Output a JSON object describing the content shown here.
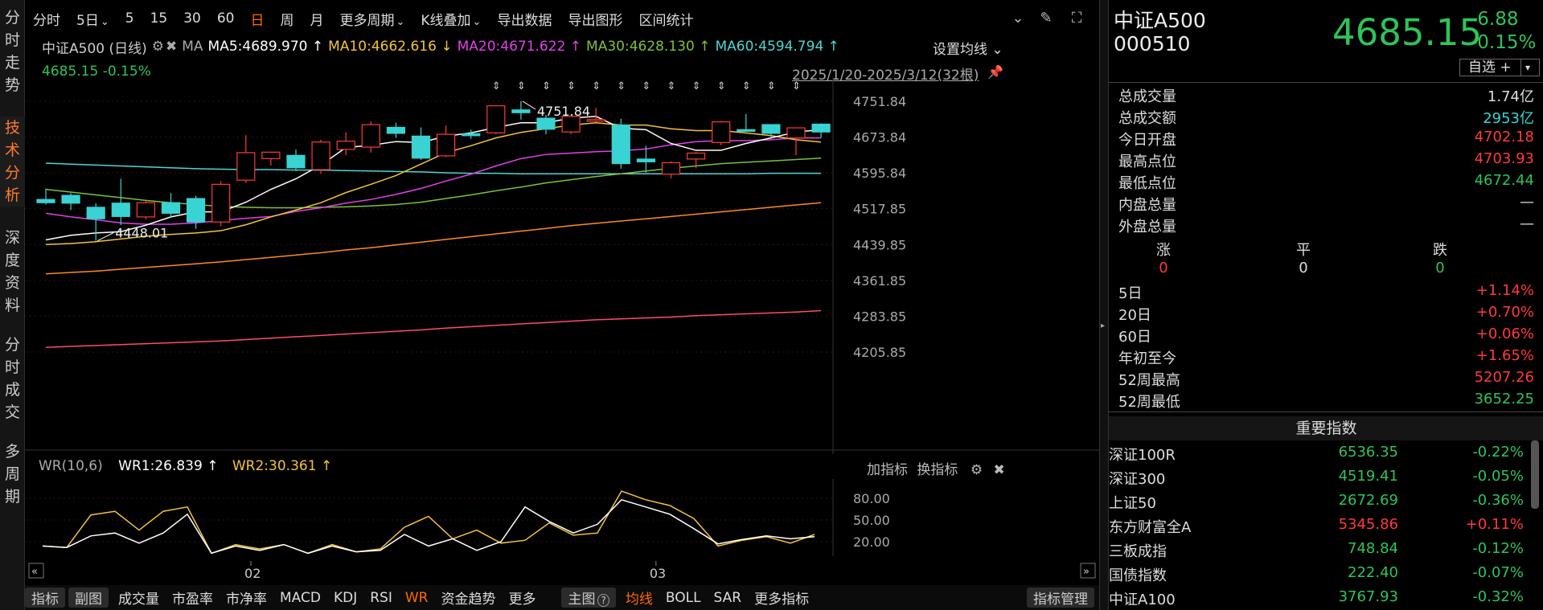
{
  "left_nav": [
    {
      "label": "分时走势"
    },
    {
      "label": "技术分析",
      "active": true
    },
    {
      "label": "深度资料"
    },
    {
      "label": "分时成交"
    },
    {
      "label": "多周期"
    }
  ],
  "toolbar": {
    "items": [
      "分时",
      "5日",
      "5",
      "15",
      "30",
      "60",
      "日",
      "周",
      "月",
      "更多周期",
      "K线叠加",
      "导出数据",
      "导出图形",
      "区间统计"
    ],
    "active": "日",
    "dropdowns": [
      "5日",
      "更多周期",
      "K线叠加"
    ]
  },
  "ma_line": {
    "name": "中证A500 (日线)",
    "ma_label": "MA",
    "ma5": "MA5:4689.970",
    "ma5_arrow": "↑",
    "ma10": "MA10:4662.616",
    "ma10_arrow": "↓",
    "ma20": "MA20:4671.622",
    "ma20_arrow": "↑",
    "ma30": "MA30:4628.130",
    "ma30_arrow": "↑",
    "ma60": "MA60:4594.794",
    "ma60_arrow": "↑",
    "set_ma": "设置均线",
    "colors": {
      "ma5": "#ffffff",
      "ma10": "#f2c33c",
      "ma20": "#e040e8",
      "ma30": "#7ec03a",
      "ma60": "#4fd4d4",
      "ma120": "#ff8a20",
      "ma250": "#ff4a6a"
    }
  },
  "price_change": "4685.15 -0.15%",
  "date_range": "2025/1/20-2025/3/12(32根)",
  "y_axis": [
    "4751.84",
    "4673.84",
    "4595.84",
    "4517.85",
    "4439.85",
    "4361.85",
    "4283.85",
    "4205.85"
  ],
  "annotations": {
    "high": "4751.84",
    "low": "4448.01"
  },
  "chart_data": {
    "type": "candlestick",
    "ylim": [
      4205.85,
      4751.84
    ],
    "up_color": "#ff3a3a",
    "down_color": "#39d3d3",
    "candles": [
      {
        "o": 4538,
        "h": 4562,
        "l": 4527,
        "c": 4531
      },
      {
        "o": 4547,
        "h": 4552,
        "l": 4515,
        "c": 4530
      },
      {
        "o": 4521,
        "h": 4530,
        "l": 4448,
        "c": 4496
      },
      {
        "o": 4530,
        "h": 4583,
        "l": 4482,
        "c": 4501
      },
      {
        "o": 4500,
        "h": 4535,
        "l": 4495,
        "c": 4531
      },
      {
        "o": 4531,
        "h": 4552,
        "l": 4498,
        "c": 4508
      },
      {
        "o": 4540,
        "h": 4546,
        "l": 4474,
        "c": 4489
      },
      {
        "o": 4489,
        "h": 4578,
        "l": 4480,
        "c": 4571
      },
      {
        "o": 4580,
        "h": 4678,
        "l": 4574,
        "c": 4640
      },
      {
        "o": 4627,
        "h": 4640,
        "l": 4612,
        "c": 4641
      },
      {
        "o": 4634,
        "h": 4647,
        "l": 4600,
        "c": 4607
      },
      {
        "o": 4603,
        "h": 4668,
        "l": 4594,
        "c": 4663
      },
      {
        "o": 4647,
        "h": 4684,
        "l": 4634,
        "c": 4665
      },
      {
        "o": 4652,
        "h": 4708,
        "l": 4640,
        "c": 4701
      },
      {
        "o": 4695,
        "h": 4705,
        "l": 4672,
        "c": 4682
      },
      {
        "o": 4676,
        "h": 4695,
        "l": 4624,
        "c": 4628
      },
      {
        "o": 4633,
        "h": 4699,
        "l": 4630,
        "c": 4680
      },
      {
        "o": 4681,
        "h": 4690,
        "l": 4670,
        "c": 4677
      },
      {
        "o": 4683,
        "h": 4743,
        "l": 4680,
        "c": 4742
      },
      {
        "o": 4733,
        "h": 4752,
        "l": 4712,
        "c": 4727
      },
      {
        "o": 4715,
        "h": 4722,
        "l": 4680,
        "c": 4691
      },
      {
        "o": 4685,
        "h": 4721,
        "l": 4680,
        "c": 4719
      },
      {
        "o": 4709,
        "h": 4738,
        "l": 4706,
        "c": 4712
      },
      {
        "o": 4700,
        "h": 4714,
        "l": 4605,
        "c": 4616
      },
      {
        "o": 4626,
        "h": 4655,
        "l": 4596,
        "c": 4620
      },
      {
        "o": 4593,
        "h": 4621,
        "l": 4584,
        "c": 4618
      },
      {
        "o": 4626,
        "h": 4642,
        "l": 4606,
        "c": 4639
      },
      {
        "o": 4662,
        "h": 4709,
        "l": 4656,
        "c": 4707
      },
      {
        "o": 4690,
        "h": 4724,
        "l": 4688,
        "c": 4688
      },
      {
        "o": 4701,
        "h": 4702,
        "l": 4673,
        "c": 4682
      },
      {
        "o": 4672,
        "h": 4695,
        "l": 4634,
        "c": 4694
      },
      {
        "o": 4702,
        "h": 4704,
        "l": 4672,
        "c": 4685
      }
    ],
    "ma5": [
      4450,
      4460,
      4465,
      4468,
      4482,
      4500,
      4511,
      4511,
      4532,
      4560,
      4583,
      4613,
      4651,
      4656,
      4664,
      4662,
      4676,
      4683,
      4695,
      4705,
      4705,
      4715,
      4719,
      4693,
      4690,
      4660,
      4645,
      4645,
      4660,
      4672,
      4685,
      4690
    ],
    "ma10": [
      4440,
      4442,
      4446,
      4452,
      4458,
      4462,
      4465,
      4470,
      4483,
      4500,
      4515,
      4531,
      4553,
      4571,
      4590,
      4615,
      4640,
      4655,
      4672,
      4684,
      4692,
      4700,
      4705,
      4700,
      4700,
      4692,
      4688,
      4688,
      4683,
      4677,
      4668,
      4663
    ],
    "ma20": [
      4508,
      4500,
      4494,
      4487,
      4484,
      4484,
      4487,
      4492,
      4497,
      4501,
      4512,
      4520,
      4530,
      4538,
      4549,
      4562,
      4578,
      4593,
      4611,
      4627,
      4636,
      4639,
      4642,
      4644,
      4648,
      4657,
      4664,
      4666,
      4666,
      4668,
      4672,
      4672
    ],
    "ma30": [
      4560,
      4554,
      4548,
      4542,
      4536,
      4531,
      4527,
      4523,
      4521,
      4520,
      4520,
      4521,
      4522,
      4524,
      4527,
      4532,
      4540,
      4548,
      4557,
      4565,
      4574,
      4581,
      4588,
      4594,
      4600,
      4606,
      4611,
      4616,
      4619,
      4622,
      4625,
      4628
    ],
    "ma60": [
      4617,
      4615,
      4613,
      4611,
      4609,
      4607,
      4605,
      4604,
      4603,
      4603,
      4602,
      4602,
      4601,
      4600,
      4599,
      4598,
      4596,
      4595,
      4595,
      4594,
      4594,
      4594,
      4594,
      4594,
      4594,
      4594,
      4594,
      4594,
      4594,
      4595,
      4595,
      4595
    ],
    "ma120": [
      4376,
      4379,
      4382,
      4386,
      4390,
      4394,
      4398,
      4402,
      4407,
      4412,
      4417,
      4422,
      4428,
      4433,
      4439,
      4445,
      4451,
      4457,
      4463,
      4469,
      4475,
      4481,
      4486,
      4491,
      4496,
      4501,
      4506,
      4511,
      4516,
      4521,
      4526,
      4531
    ],
    "ma250": [
      4216,
      4218,
      4220,
      4222,
      4224,
      4226,
      4228,
      4230,
      4233,
      4236,
      4239,
      4242,
      4245,
      4248,
      4251,
      4254,
      4258,
      4261,
      4264,
      4267,
      4270,
      4273,
      4276,
      4278,
      4280,
      4282,
      4285,
      4287,
      4289,
      4291,
      4293,
      4296
    ]
  },
  "wr": {
    "title": "WR(10,6)",
    "wr1": "WR1:26.839",
    "wr1_arrow": "↑",
    "wr2": "WR2:30.361",
    "wr2_arrow": "↑",
    "tools": [
      "加指标",
      "换指标"
    ],
    "y_axis": [
      "80.00",
      "50.00",
      "20.00"
    ],
    "ylim": [
      0,
      100
    ],
    "wr1_values": [
      14,
      12,
      28,
      32,
      18,
      32,
      58,
      4,
      14,
      8,
      16,
      4,
      14,
      6,
      8,
      30,
      14,
      24,
      8,
      20,
      68,
      48,
      32,
      44,
      78,
      68,
      58,
      38,
      17,
      23,
      28,
      24,
      27
    ],
    "wr2_values": [
      14,
      12,
      57,
      62,
      36,
      62,
      68,
      4,
      16,
      10,
      16,
      4,
      16,
      6,
      10,
      40,
      55,
      24,
      36,
      18,
      22,
      46,
      29,
      32,
      90,
      78,
      70,
      52,
      14,
      22,
      27,
      18,
      30
    ]
  },
  "x_axis": {
    "labels": [
      "02",
      "03"
    ]
  },
  "bottom_bar": {
    "items": [
      {
        "label": "指标",
        "style": "boxed"
      },
      {
        "label": "副图",
        "style": "boxed"
      },
      {
        "label": "成交量"
      },
      {
        "label": "市盈率"
      },
      {
        "label": "市净率"
      },
      {
        "label": "MACD"
      },
      {
        "label": "KDJ"
      },
      {
        "label": "RSI"
      },
      {
        "label": "WR",
        "style": "orange"
      },
      {
        "label": "资金趋势"
      },
      {
        "label": "更多"
      },
      {
        "label": "主图",
        "style": "boxed"
      },
      {
        "label": "均线",
        "style": "orange"
      },
      {
        "label": "BOLL"
      },
      {
        "label": "SAR"
      },
      {
        "label": "更多指标"
      }
    ],
    "manage": "指标管理"
  },
  "quote": {
    "name": "中证A500",
    "code": "000510",
    "price": "4685.15",
    "change": "-6.88",
    "change_pct": "-0.15%",
    "self_select": "自选 +",
    "stats": [
      {
        "label": "总成交量",
        "value": "1.74亿",
        "color": "white"
      },
      {
        "label": "总成交额",
        "value": "2953亿",
        "color": "cyan"
      },
      {
        "label": "今日开盘",
        "value": "4702.18",
        "color": "red"
      },
      {
        "label": "最高点位",
        "value": "4703.93",
        "color": "red"
      },
      {
        "label": "最低点位",
        "value": "4672.44",
        "color": "green"
      },
      {
        "label": "内盘总量",
        "value": "—",
        "color": "white"
      },
      {
        "label": "外盘总量",
        "value": "—",
        "color": "white"
      }
    ],
    "updown": {
      "up_label": "涨",
      "flat_label": "平",
      "down_label": "跌",
      "up": "0",
      "flat": "0",
      "down": "0"
    },
    "perf": [
      {
        "label": "5日",
        "value": "+1.14%",
        "color": "red"
      },
      {
        "label": "20日",
        "value": "+0.70%",
        "color": "red"
      },
      {
        "label": "60日",
        "value": "+0.06%",
        "color": "red"
      },
      {
        "label": "年初至今",
        "value": "+1.65%",
        "color": "red"
      },
      {
        "label": "52周最高",
        "value": "5207.26",
        "color": "red"
      },
      {
        "label": "52周最低",
        "value": "3652.25",
        "color": "green"
      }
    ]
  },
  "key_indices": {
    "title": "重要指数",
    "rows": [
      {
        "name": "深证100R",
        "value": "6536.35",
        "change": "-0.22%",
        "color": "green"
      },
      {
        "name": "深证300",
        "value": "4519.41",
        "change": "-0.05%",
        "color": "green"
      },
      {
        "name": "上证50",
        "value": "2672.69",
        "change": "-0.36%",
        "color": "green"
      },
      {
        "name": "东方财富全A",
        "value": "5345.86",
        "change": "+0.11%",
        "color": "red"
      },
      {
        "name": "三板成指",
        "value": "748.84",
        "change": "-0.12%",
        "color": "green"
      },
      {
        "name": "国债指数",
        "value": "222.40",
        "change": "-0.07%",
        "color": "green"
      },
      {
        "name": "中证A100",
        "value": "3767.93",
        "change": "-0.32%",
        "color": "green"
      }
    ]
  }
}
